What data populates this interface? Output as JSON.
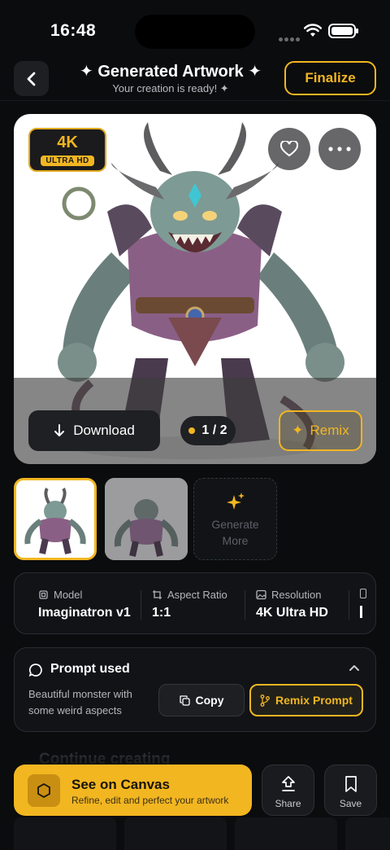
{
  "status": {
    "time": "16:48"
  },
  "header": {
    "title": "✦ Generated Artwork ✦",
    "subtitle": "Your creation is ready! ✦",
    "finalize_label": "Finalize"
  },
  "artwork": {
    "badge_main": "4K",
    "badge_sub": "ULTRA HD",
    "download_label": "Download",
    "pager_text": "1 / 2",
    "remix_label": "Remix"
  },
  "generate_more_label_1": "Generate",
  "generate_more_label_2": "More",
  "details": [
    {
      "key": "Model",
      "value": "Imaginatron v1",
      "icon": "chip-icon"
    },
    {
      "key": "Aspect Ratio",
      "value": "1:1",
      "icon": "crop-icon"
    },
    {
      "key": "Resolution",
      "value": "4K Ultra HD",
      "icon": "image-icon"
    }
  ],
  "prompt": {
    "title": "Prompt used",
    "text": "Beautiful monster with some weird aspects",
    "copy_label": "Copy",
    "remix_label": "Remix Prompt"
  },
  "continue_label": "Continue creating",
  "bottom": {
    "canvas_title": "See on Canvas",
    "canvas_sub": "Refine, edit and perfect your artwork",
    "share_label": "Share",
    "save_label": "Save"
  },
  "colors": {
    "accent": "#f2b621",
    "background": "#0b0c0e",
    "panel": "#121317"
  }
}
